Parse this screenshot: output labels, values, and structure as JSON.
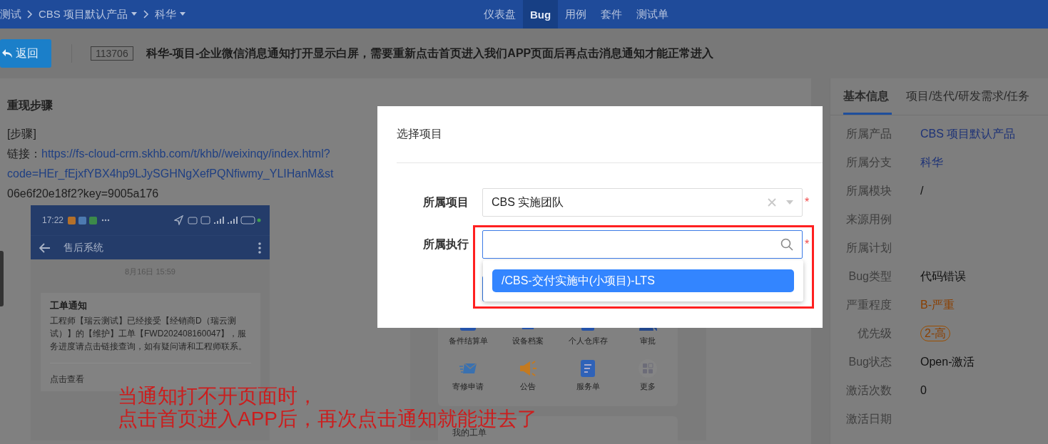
{
  "top_bar": {
    "breadcrumbs": [
      {
        "label": "测试",
        "has_menu": false
      },
      {
        "label": "CBS 项目默认产品",
        "has_menu": true
      },
      {
        "label": "科华",
        "has_menu": true
      }
    ],
    "nav_tabs": [
      {
        "label": "仪表盘",
        "selected": false
      },
      {
        "label": "Bug",
        "selected": true
      },
      {
        "label": "用例",
        "selected": false
      },
      {
        "label": "套件",
        "selected": false
      },
      {
        "label": "测试单",
        "selected": false
      }
    ]
  },
  "header": {
    "back_button": "返回",
    "bug_id": "113706",
    "title": "科华-项目-企业微信消息通知打开显示白屏，需要重新点击首页进入我们APP页面后再点击消息通知才能正常进入"
  },
  "steps": {
    "heading": "重现步骤",
    "lines": [
      {
        "kind": "text",
        "text": "[步骤]"
      },
      {
        "kind": "link",
        "prefix": "链接：",
        "link": "https://fs-cloud-crm.skhb.com/t/khb//weixinqy/index.html?"
      },
      {
        "kind": "link",
        "link": "code=HEr_fEjxfYBX4hp9LJySGHNgXefPQNfiwmy_YLIHanM&st"
      },
      {
        "kind": "text",
        "text": "06e6f20e18f2?key=9005a176"
      }
    ]
  },
  "chat_screenshot": {
    "time": "17:22",
    "app_title": "售后系统",
    "date": "8月16日 15:59",
    "card": {
      "title": "工单通知",
      "body": "工程师【瑞云测试】已经接受【经销商D（瑞云测试）】的【维护】工单【FWD202408160047】，服务进度请点击链接查询，如有疑问请和工程师联系。",
      "action": "点击查看"
    }
  },
  "app_screenshot": {
    "apps": [
      {
        "label": "备件结算单"
      },
      {
        "label": "设备档案"
      },
      {
        "label": "个人仓库存"
      },
      {
        "label": "审批"
      },
      {
        "label": "寄修申请"
      },
      {
        "label": "公告"
      },
      {
        "label": "服务单"
      },
      {
        "label": "更多"
      }
    ],
    "section": "我的工单"
  },
  "annotation": {
    "lines": [
      "当通知打不开页面时，",
      "点击首页进入APP后，再次点击通知就能进去了"
    ]
  },
  "details": {
    "tabs": [
      {
        "label": "基本信息",
        "selected": true
      },
      {
        "label": "项目/迭代/研发需求/任务",
        "selected": false
      }
    ],
    "fields": [
      {
        "label": "所属产品",
        "value": "CBS 项目默认产品",
        "kind": "link"
      },
      {
        "label": "所属分支",
        "value": "科华",
        "kind": "link"
      },
      {
        "label": "所属模块",
        "value": "/",
        "kind": "text"
      },
      {
        "label": "来源用例"
      },
      {
        "label": "所属计划"
      },
      {
        "label": "Bug类型",
        "value": "代码错误",
        "kind": "text"
      },
      {
        "label": "严重程度",
        "value": "B-严重",
        "kind": "severity"
      },
      {
        "label": "优先级",
        "value": "2-高",
        "kind": "badge"
      },
      {
        "label": "Bug状态",
        "value": "Open-激活",
        "kind": "text"
      },
      {
        "label": "激活次数",
        "value": "0",
        "kind": "text"
      },
      {
        "label": "激活日期"
      }
    ]
  },
  "dialog": {
    "title": "选择项目",
    "fields": [
      {
        "label": "所属项目",
        "kind": "select",
        "value": "CBS 实施团队",
        "clearable": true,
        "focused": false,
        "required_mark": "*"
      },
      {
        "label": "所属执行",
        "kind": "search",
        "focused": true,
        "required_mark": "*"
      }
    ],
    "dropdown": {
      "options": [
        {
          "label": "/CBS-交付实施中(小项目)-LTS",
          "selected": true
        }
      ]
    }
  }
}
